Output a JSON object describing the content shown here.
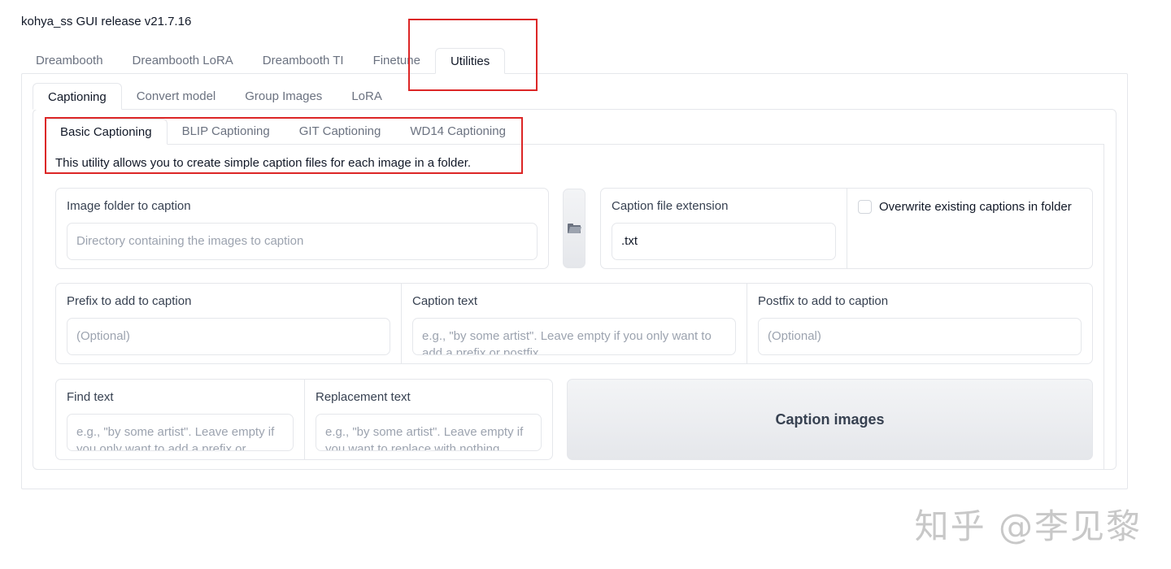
{
  "app": {
    "title": "kohya_ss GUI release v21.7.16"
  },
  "top_tabs": [
    {
      "label": "Dreambooth"
    },
    {
      "label": "Dreambooth LoRA"
    },
    {
      "label": "Dreambooth TI"
    },
    {
      "label": "Finetune"
    },
    {
      "label": "Utilities",
      "active": true
    }
  ],
  "mid_tabs": [
    {
      "label": "Captioning",
      "active": true
    },
    {
      "label": "Convert model"
    },
    {
      "label": "Group Images"
    },
    {
      "label": "LoRA"
    }
  ],
  "inner_tabs": [
    {
      "label": "Basic Captioning",
      "active": true
    },
    {
      "label": "BLIP Captioning"
    },
    {
      "label": "GIT Captioning"
    },
    {
      "label": "WD14 Captioning"
    }
  ],
  "description": "This utility allows you to create simple caption files for each image in a folder.",
  "image_folder": {
    "label": "Image folder to caption",
    "placeholder": "Directory containing the images to caption"
  },
  "caption_ext": {
    "label": "Caption file extension",
    "value": ".txt"
  },
  "overwrite": {
    "label": "Overwrite existing captions in folder",
    "checked": false
  },
  "prefix": {
    "label": "Prefix to add to caption",
    "placeholder": "(Optional)"
  },
  "caption_text": {
    "label": "Caption text",
    "placeholder": "e.g., \"by some artist\". Leave empty if you only want to add a prefix or postfix."
  },
  "postfix": {
    "label": "Postfix to add to caption",
    "placeholder": "(Optional)"
  },
  "find_text": {
    "label": "Find text",
    "placeholder": "e.g., \"by some artist\". Leave empty if you only want to add a prefix or postfix."
  },
  "replacement_text": {
    "label": "Replacement text",
    "placeholder": "e.g., \"by some artist\". Leave empty if you want to replace with nothing."
  },
  "caption_button": {
    "label": "Caption images"
  },
  "watermark": "知乎 @李见黎",
  "colors": {
    "annotation": "#dc2626",
    "border": "#e5e7eb",
    "muted_text": "#6b7280"
  }
}
